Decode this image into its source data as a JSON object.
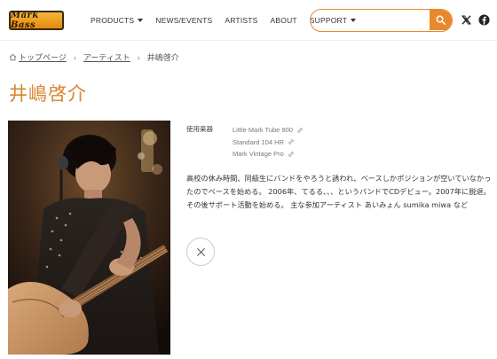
{
  "header": {
    "logo_text": "Mark Bass",
    "nav": [
      {
        "label": "PRODUCTS",
        "dropdown": true
      },
      {
        "label": "NEWS/EVENTS",
        "dropdown": false
      },
      {
        "label": "ARTISTS",
        "dropdown": false
      },
      {
        "label": "ABOUT",
        "dropdown": false
      },
      {
        "label": "SUPPORT",
        "dropdown": true
      }
    ],
    "search": {
      "value": "",
      "placeholder": ""
    },
    "accent_color": "#e8892e"
  },
  "breadcrumb": {
    "home": "トップページ",
    "artists": "アーティスト",
    "current": "井嶋啓介"
  },
  "title": "井嶋啓介",
  "instruments": {
    "label": "使用楽器",
    "items": [
      "Little Mark Tube 800",
      "Standard 104 HR",
      "Mark Vintage Pro"
    ]
  },
  "bio": "高校の休み時間、同級生にバンドをやろうと誘われ、ベースしかポジションが空いていなかったのでベースを始める。 2006年、てるる、、、というバンドでCDデビュー。2007年に脱退。その後サポート活動を始める。 主な参加アーティスト あいみょん sumika miwa など"
}
